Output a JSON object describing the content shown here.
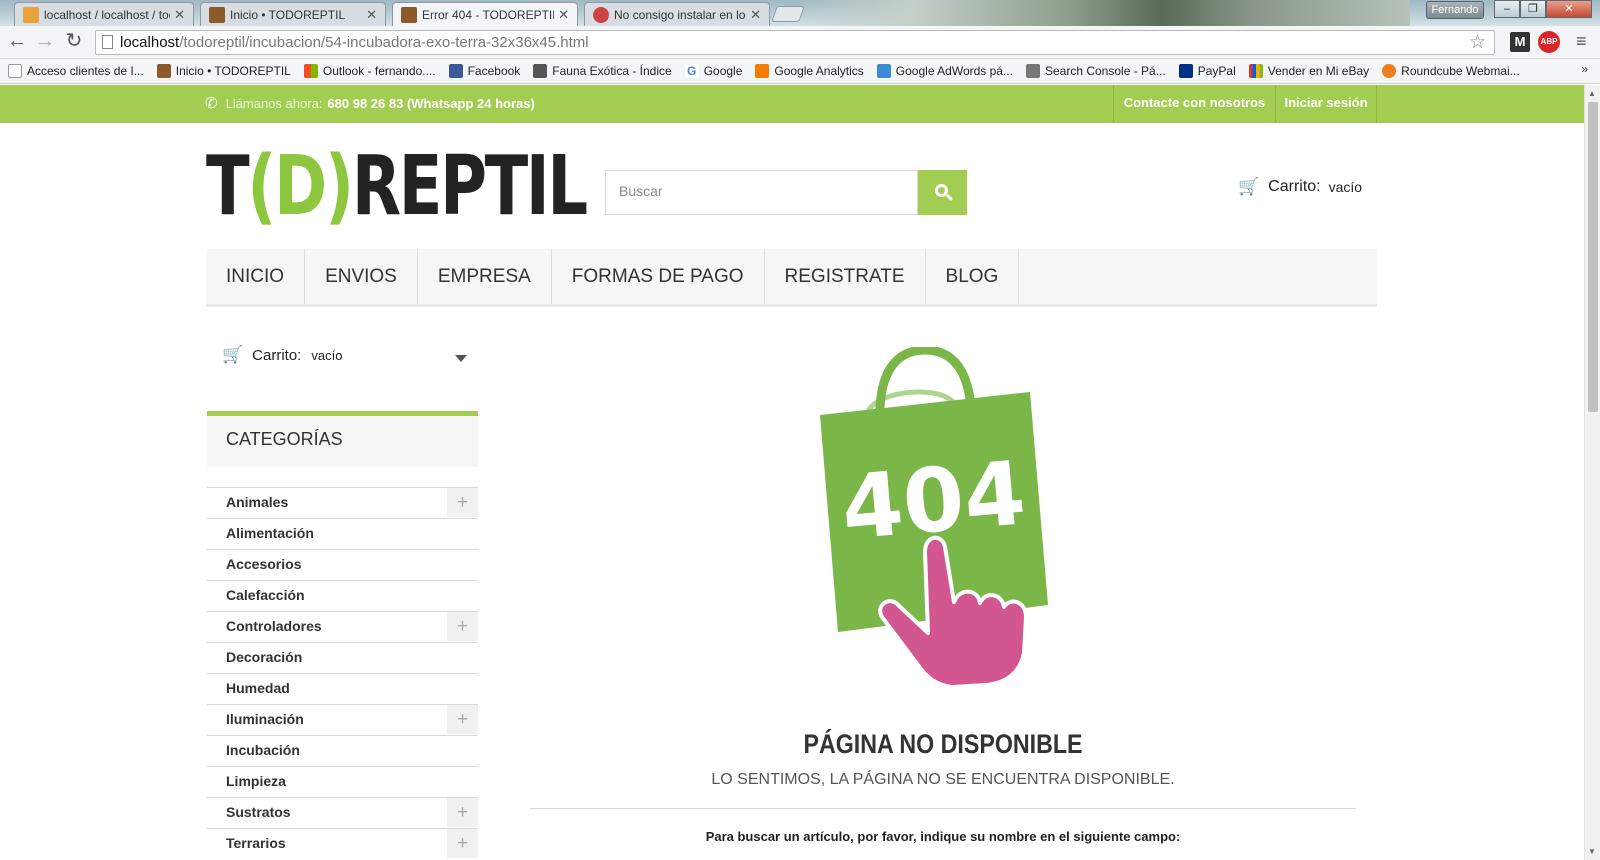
{
  "browser": {
    "tabs": [
      {
        "label": "localhost / localhost / todo",
        "active": false,
        "favicon_color": "#e8a33c"
      },
      {
        "label": "Inicio • TODOREPTIL",
        "active": false,
        "favicon_color": "#8a5a2a"
      },
      {
        "label": "Error 404 - TODOREPTIL",
        "active": true,
        "favicon_color": "#8a5a2a"
      },
      {
        "label": "No consigo instalar en loc",
        "active": false,
        "favicon_color": "#c44"
      }
    ],
    "user_badge": "Fernando",
    "window_buttons": {
      "minimize": "–",
      "restore": "❐",
      "close": "✕"
    },
    "nav": {
      "back": "←",
      "forward": "→",
      "reload": "↻"
    },
    "url_host": "localhost",
    "url_path": "/todoreptil/incubacion/54-incubadora-exo-terra-32x36x45.html",
    "extensions": {
      "m_label": "M",
      "abp_label": "ABP"
    },
    "menu_glyph": "≡",
    "bookmarks": [
      {
        "label": "Acceso clientes de I...",
        "icon_color": "#ffffff"
      },
      {
        "label": "Inicio • TODOREPTIL",
        "icon_color": "#8a5a2a"
      },
      {
        "label": "Outlook - fernando....",
        "icon_color": "#f25022"
      },
      {
        "label": "Facebook",
        "icon_color": "#3b5998"
      },
      {
        "label": "Fauna Exótica - Índice",
        "icon_color": "#555555"
      },
      {
        "label": "Google",
        "icon_color": "#4285f4"
      },
      {
        "label": "Google Analytics",
        "icon_color": "#f57c00"
      },
      {
        "label": "Google AdWords pá...",
        "icon_color": "#3c8bd9"
      },
      {
        "label": "Search Console - Pá...",
        "icon_color": "#777777"
      },
      {
        "label": "PayPal",
        "icon_color": "#003087"
      },
      {
        "label": "Vender en Mi eBay",
        "icon_color": "#e53238"
      },
      {
        "label": "Roundcube Webmai...",
        "icon_color": "#f07d1e"
      }
    ],
    "bookmarks_more": "»"
  },
  "topbar": {
    "phone_prefix": "Llámanos ahora:",
    "phone_number": "680 98 26 83 (Whatsapp 24 horas)",
    "contact_link": "Contacte con nosotros",
    "login_link": "Iniciar sesión"
  },
  "header": {
    "logo_parts": [
      "T",
      "(D)",
      "REPTIL"
    ],
    "search_placeholder": "Buscar",
    "cart_label": "Carrito:",
    "cart_state": "vacío"
  },
  "main_nav": [
    "INICIO",
    "ENVIOS",
    "EMPRESA",
    "FORMAS DE PAGO",
    "REGISTRATE",
    "BLOG"
  ],
  "sidebar": {
    "cart_label": "Carrito:",
    "cart_state": "vacío",
    "categories_title": "CATEGORÍAS",
    "categories": [
      {
        "label": "Animales",
        "expandable": true
      },
      {
        "label": "Alimentación",
        "expandable": false
      },
      {
        "label": "Accesorios",
        "expandable": false
      },
      {
        "label": "Calefacción",
        "expandable": false
      },
      {
        "label": "Controladores",
        "expandable": true
      },
      {
        "label": "Decoración",
        "expandable": false
      },
      {
        "label": "Humedad",
        "expandable": false
      },
      {
        "label": "Iluminación",
        "expandable": true
      },
      {
        "label": "Incubación",
        "expandable": false
      },
      {
        "label": "Limpieza",
        "expandable": false
      },
      {
        "label": "Sustratos",
        "expandable": true
      },
      {
        "label": "Terrarios",
        "expandable": true
      }
    ]
  },
  "error": {
    "code": "404",
    "title": "PÁGINA NO DISPONIBLE",
    "subtitle": "LO SENTIMOS, LA PÁGINA NO SE ENCUENTRA DISPONIBLE.",
    "hint": "Para buscar un artículo, por favor, indique su nombre en el siguiente campo:"
  },
  "colors": {
    "brand_green": "#a3cd52",
    "logo_green": "#8dc63f",
    "bag_green": "#7ab648",
    "hand_pink": "#d2568f"
  }
}
